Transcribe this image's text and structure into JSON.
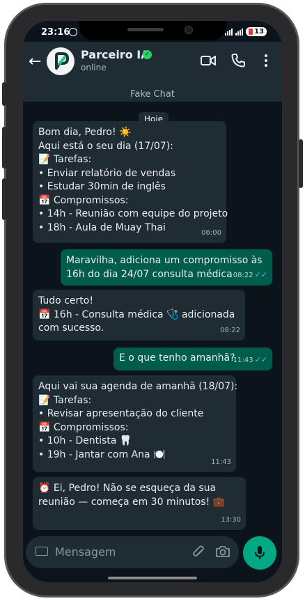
{
  "status_bar": {
    "time": "23:16",
    "battery": "13"
  },
  "header": {
    "back_icon": "arrow-left-icon",
    "contact_name": "Parceiro IA",
    "status": "online",
    "subtitle": "Fake Chat",
    "icons": [
      "video-call-icon",
      "voice-call-icon",
      "more-vert-icon"
    ]
  },
  "chat": {
    "day_separator": "Hoje",
    "messages": [
      {
        "dir": "in",
        "time": "06:00",
        "lines": [
          "Bom dia, Pedro! ☀️",
          "Aqui está o seu dia (17/07):",
          "📝 Tarefas:",
          "• Enviar relatório de vendas",
          "• Estudar 30min de inglês",
          "📅 Compromissos:",
          "• 14h - Reunião com equipe do projeto",
          "• 18h - Aula de Muay Thai"
        ]
      },
      {
        "dir": "out",
        "time": "08:22",
        "lines": [
          "Maravilha, adiciona um compromisso às",
          "16h do dia 24/07 consulta médica"
        ]
      },
      {
        "dir": "in",
        "time": "08:22",
        "lines": [
          "Tudo certo!",
          "📅 16h - Consulta médica 🩺 adicionada",
          "com sucesso."
        ]
      },
      {
        "dir": "out",
        "time": "11:43",
        "lines": [
          "E o que tenho amanhã?"
        ]
      },
      {
        "dir": "in",
        "time": "11:43",
        "lines": [
          "Aqui vai sua agenda de amanhã (18/07):",
          "📝 Tarefas:",
          "• Revisar apresentação do cliente",
          "📅 Compromissos:",
          "• 10h - Dentista 🦷",
          "• 19h - Jantar com Ana 🍽️"
        ]
      },
      {
        "dir": "in",
        "time": "13:30",
        "lines": [
          "⏰ Ei, Pedro! Não se esqueça da sua",
          "reunião — começa em 30 minutos! 💼"
        ]
      }
    ]
  },
  "composer": {
    "placeholder": "Mensagem"
  },
  "colors": {
    "accent": "#00a884",
    "incoming": "#202c33",
    "outgoing": "#005c4b",
    "background": "#0b141a"
  }
}
